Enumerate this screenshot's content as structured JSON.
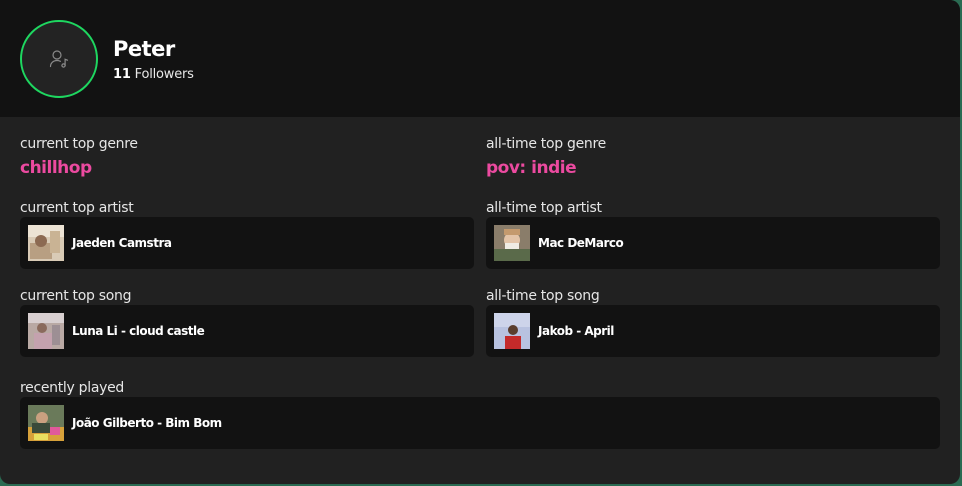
{
  "profile": {
    "name": "Peter",
    "followers_count": "11",
    "followers_label": "Followers",
    "avatar_icon": "user-music-icon",
    "ring_color": "#1ed760"
  },
  "genres": {
    "current_label": "current top genre",
    "current_value": "chillhop",
    "alltime_label": "all-time top genre",
    "alltime_value": "pov: indie",
    "accent_color": "#ec4aa0"
  },
  "artists": {
    "current_label": "current top artist",
    "current_name": "Jaeden Camstra",
    "alltime_label": "all-time top artist",
    "alltime_name": "Mac DeMarco"
  },
  "songs": {
    "current_label": "current top song",
    "current_title": "Luna Li - cloud castle",
    "alltime_label": "all-time top song",
    "alltime_title": "Jakob - April"
  },
  "recent": {
    "label": "recently played",
    "title": "João Gilberto - Bim Bom"
  }
}
